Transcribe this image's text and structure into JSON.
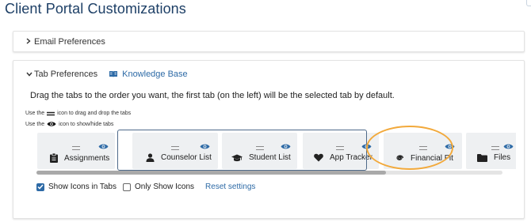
{
  "page": {
    "title": "Client Portal Customizations"
  },
  "email_section": {
    "label": "Email Preferences"
  },
  "tab_section": {
    "label": "Tab Preferences",
    "knowledge_base": "Knowledge Base",
    "instruction": "Drag the tabs to the order you want, the first tab (on the left) will be the selected tab by default.",
    "hint_drag_prefix": "Use the",
    "hint_drag_suffix": "icon to drag and drop the tabs",
    "hint_eye_prefix": "Use the",
    "hint_eye_suffix": "icon to show/hide tabs",
    "tabs": [
      {
        "label": "Assignments",
        "icon": "clipboard-icon",
        "visible": true
      },
      {
        "label": "Counselor List",
        "icon": "person-icon",
        "visible": true
      },
      {
        "label": "Student List",
        "icon": "graduation-cap-icon",
        "visible": true
      },
      {
        "label": "App Tracker",
        "icon": "heart-icon",
        "visible": true
      },
      {
        "label": "Financial Fit",
        "icon": "spiral-icon",
        "visible": true
      },
      {
        "label": "Files",
        "icon": "folder-icon",
        "visible": true
      }
    ],
    "scroll_position_fraction": 0.75,
    "show_icons_label": "Show Icons in Tabs",
    "show_icons_checked": true,
    "only_icons_label": "Only Show Icons",
    "only_icons_checked": false,
    "reset_label": "Reset settings"
  },
  "colors": {
    "title": "#1d3f66",
    "link": "#2d6aa6",
    "highlight": "#f2a93b",
    "group_border": "#4e6a8a",
    "tab_bg": "#eef0f2"
  }
}
